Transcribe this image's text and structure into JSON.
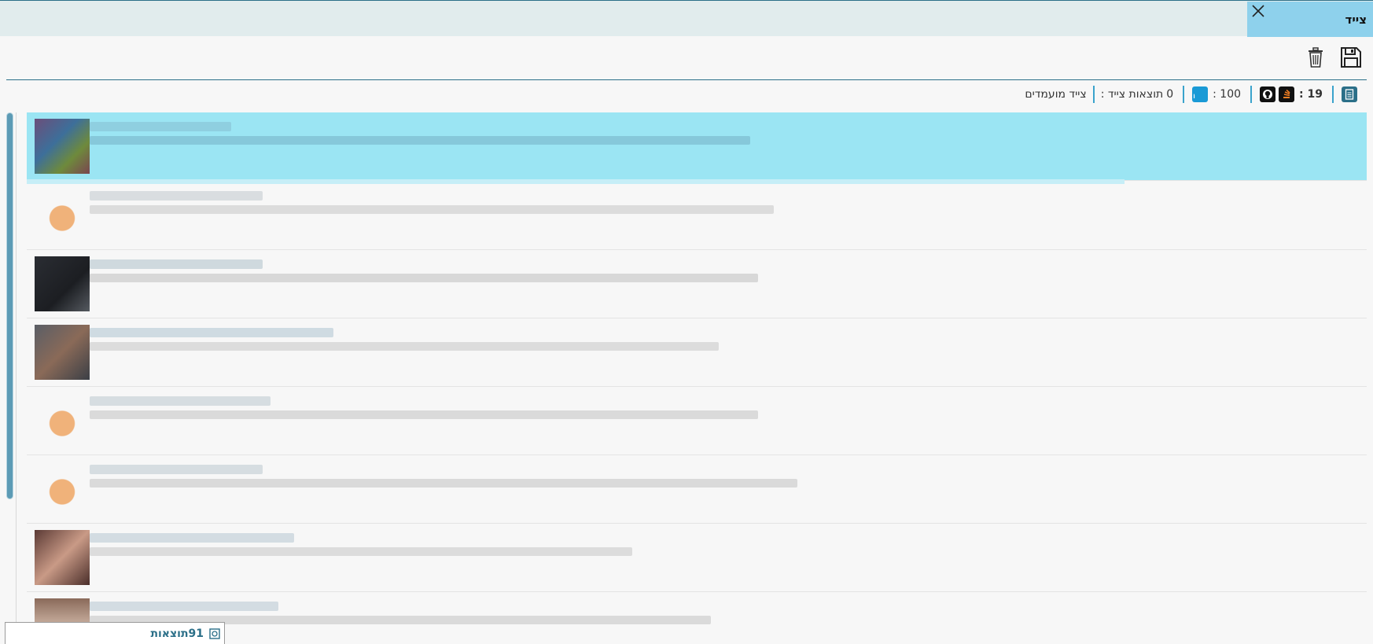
{
  "window": {
    "tab_title": "צייד",
    "close_icon": "close-icon"
  },
  "toolbar": {
    "delete_icon": "trash-icon",
    "save_icon": "floppy-disk-icon"
  },
  "status": {
    "candidates_label": "צייד מועמדים",
    "results_label": "תוצאות צייד :",
    "results_value": "0",
    "linkedin_value": ": 100",
    "combined_value": ": 19",
    "linkedin_icon": "linkedin-icon",
    "github_icon": "github-icon",
    "stackoverflow_icon": "stackoverflow-icon",
    "document_icon": "document-icon"
  },
  "colors": {
    "accent": "#2b6f88",
    "tab_bg": "#8ed1ec",
    "selected_row": "#9be5f3",
    "linkedin": "#1a9ad6"
  },
  "bottom": {
    "label": "91תוצאות"
  },
  "rows": [
    {
      "avatar": "avatar-photo",
      "selected": true
    },
    {
      "avatar": "avatar-placeholder",
      "selected": false
    },
    {
      "avatar": "avatar-photo",
      "selected": false
    },
    {
      "avatar": "avatar-photo",
      "selected": false
    },
    {
      "avatar": "avatar-placeholder",
      "selected": false
    },
    {
      "avatar": "avatar-placeholder",
      "selected": false
    },
    {
      "avatar": "avatar-photo",
      "selected": false
    },
    {
      "avatar": "avatar-photo",
      "selected": false
    }
  ]
}
